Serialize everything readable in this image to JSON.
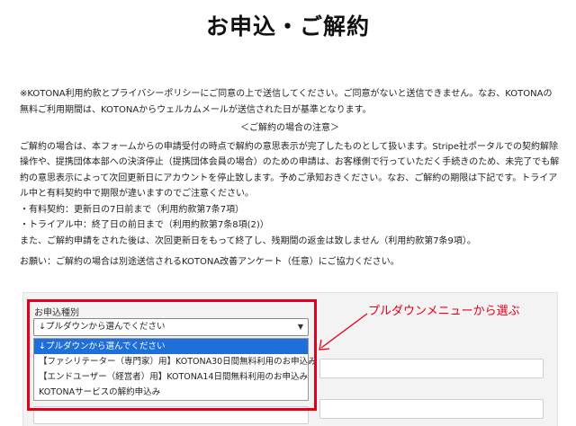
{
  "page": {
    "title": "お申込・ご解約"
  },
  "notice": {
    "consent": "※KOTONA利用約款とプライバシーポリシーにご同意の上で送信してください。ご同意がないと送信できません。なお、KOTONAの無料ご利用期間は、KOTONAからウェルカムメールが送信された日が基準となります。",
    "cancel_heading": "＜ご解約の場合の注意＞",
    "cancel_body": "ご解約の場合は、本フォームからの申請受付の時点で解約の意思表示が完了したものとして扱います。Stripe社ポータルでの契約解除操作や、提携団体本部への決済停止（提携団体会員の場合）のための申請は、お客様側で行っていただく手続きのため、未完了でも解約の意思表示によって次回更新日にアカウントを停止致します。予めご承知おきください。なお、ご解約の期限は下記です。トライアル中と有料契約中で期限が違いますのでご注意ください。",
    "paid": "・有料契約：更新日の7日前まで（利用約款第7条7項）",
    "trial": "・トライアル中：終了日の前日まで（利用約款第7条8項(2)）",
    "refund": "また、ご解約申請をされた後は、次回更新日をもって終了し、残期間の返金は致しません（利用約款第7条9項）。",
    "survey": "お願い：ご解約の場合は別途送信されるKOTONA改善アンケート（任意）にご協力ください。"
  },
  "form": {
    "type_label": "お申込種別",
    "select_value": "↓プルダウンから選んでください",
    "options": [
      {
        "label": "↓プルダウンから選んでください",
        "selected": true
      },
      {
        "label": "【ファシリテーター（専門家）用】KOTONA30日間無料利用のお申込み",
        "selected": false
      },
      {
        "label": "【エンドユーザー（経営者）用】KOTONA14日間無料利用のお申込み",
        "selected": false
      },
      {
        "label": "KOTONAサービスの解約申込み",
        "selected": false
      }
    ]
  },
  "annotation": {
    "callout": "プルダウンメニューから選ぶ",
    "color": "#e3001b"
  },
  "colors": {
    "selected_option_bg": "#1e6fd9",
    "form_bg": "#f3f3f3"
  }
}
